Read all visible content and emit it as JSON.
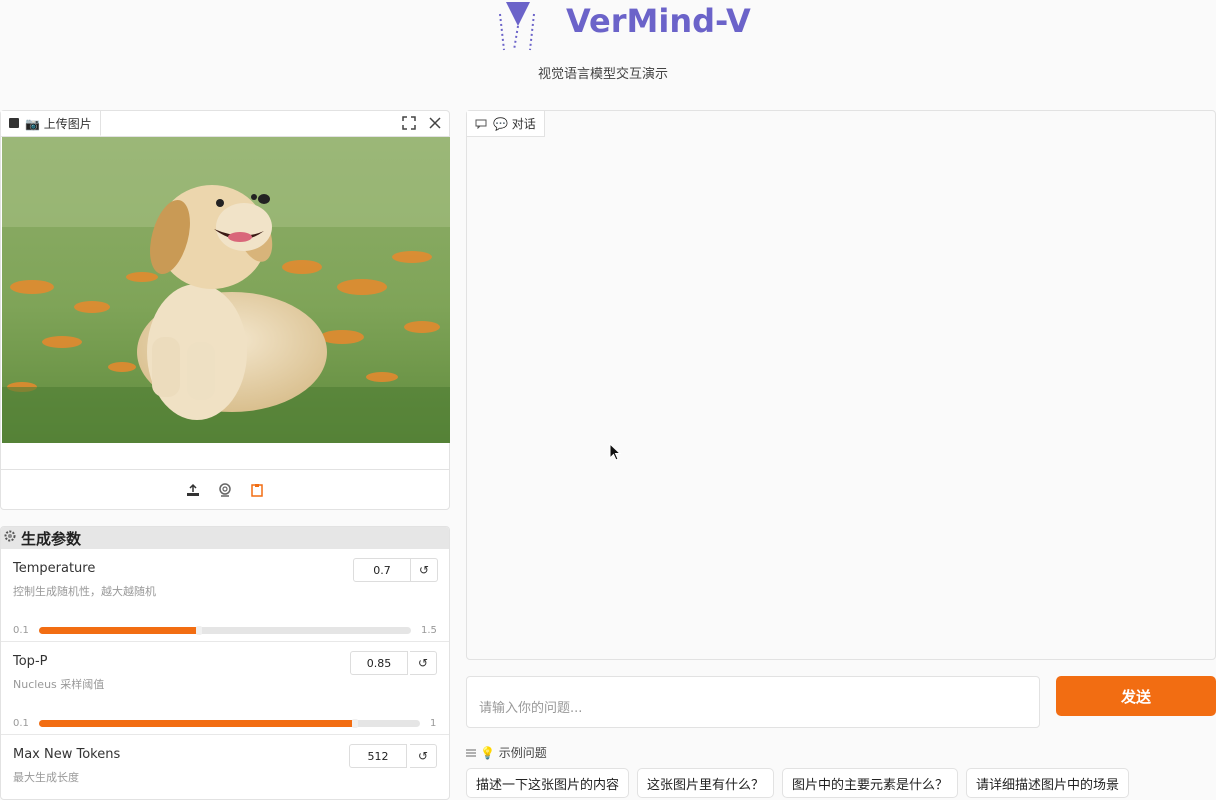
{
  "header": {
    "title": "VerMind-V",
    "subtitle": "视觉语言模型交互演示"
  },
  "upload": {
    "tab_label": "📷 上传图片",
    "image_alt": "golden retriever puppy sitting in grass with orange flowers"
  },
  "params": {
    "title": "生成参数",
    "items": [
      {
        "label": "Temperature",
        "desc": "控制生成随机性，越大越随机",
        "value": "0.7",
        "min": "0.1",
        "max": "1.5",
        "fraction": 0.43
      },
      {
        "label": "Top-P",
        "desc": "Nucleus 采样阈值",
        "value": "0.85",
        "min": "0.1",
        "max": "1",
        "fraction": 0.83
      },
      {
        "label": "Max New Tokens",
        "desc": "最大生成长度",
        "value": "512"
      }
    ]
  },
  "chat": {
    "tab_label": "💬 对话"
  },
  "input": {
    "placeholder": "请输入你的问题..."
  },
  "send_label": "发送",
  "examples": {
    "title": "💡 示例问题",
    "items": [
      "描述一下这张图片的内容",
      "这张图片里有什么？",
      "图片中的主要元素是什么？",
      "请详细描述图片中的场景"
    ]
  },
  "colors": {
    "accent": "#f26d12",
    "brand": "#6b63c9"
  }
}
